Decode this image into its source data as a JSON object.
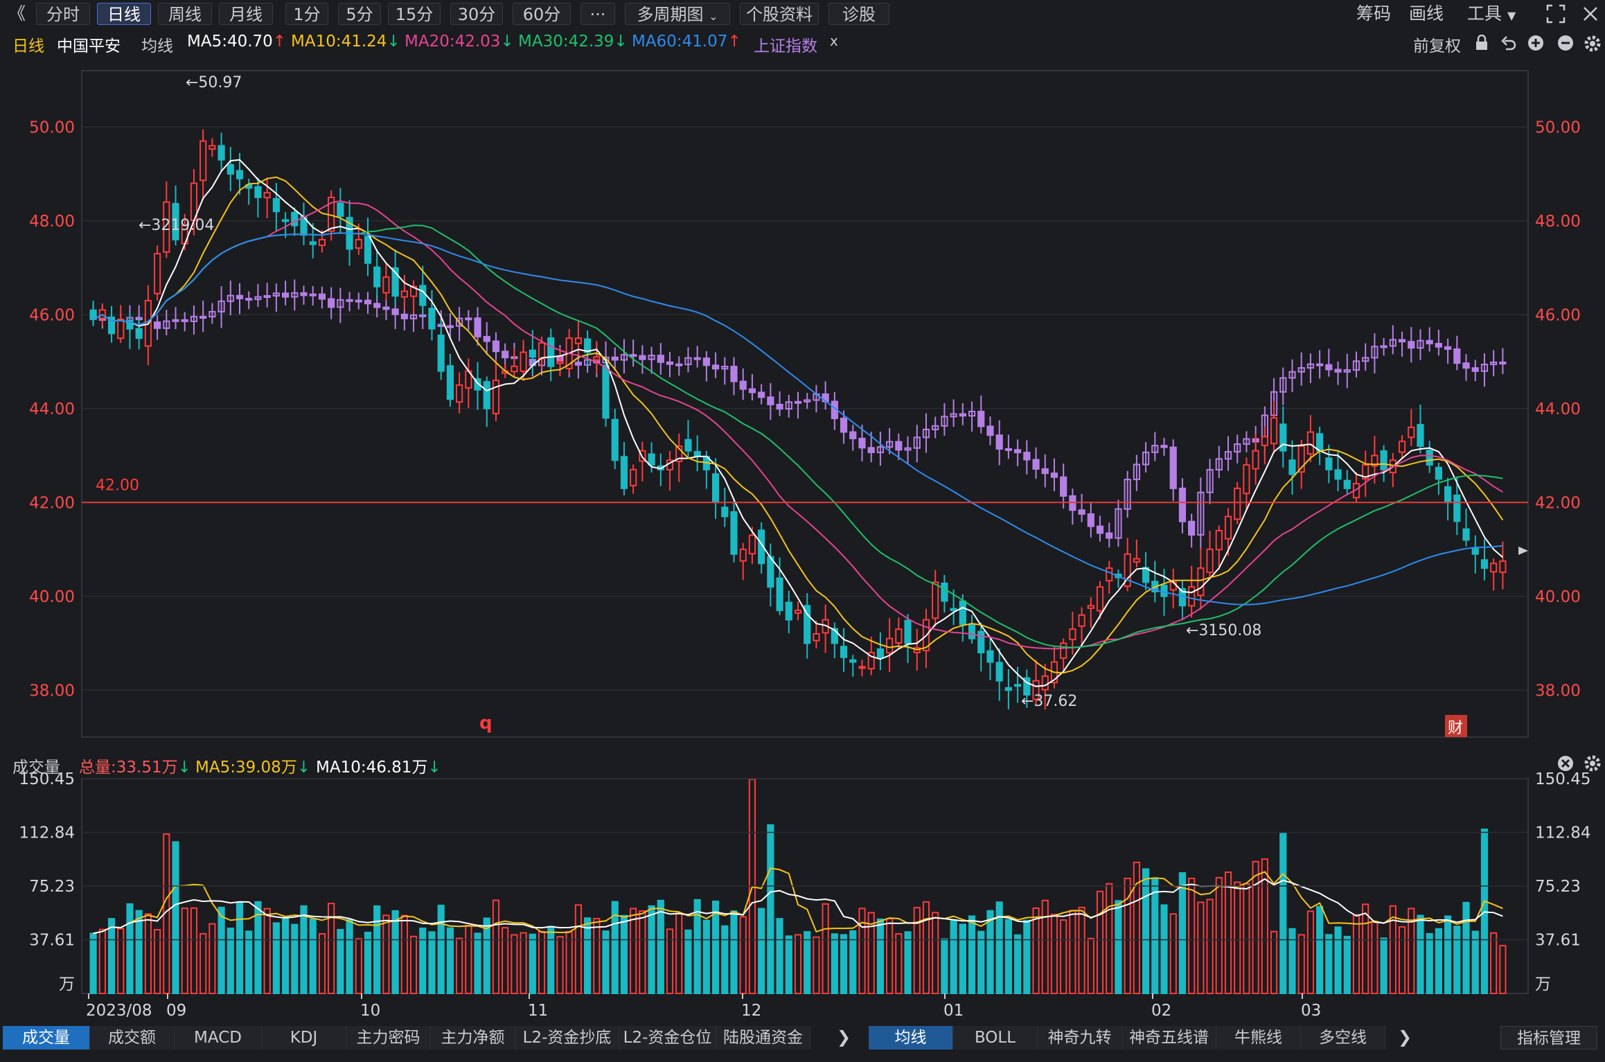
{
  "toolbar": {
    "back": "《",
    "periods": [
      "分时",
      "日线",
      "周线",
      "月线",
      "1分",
      "5分",
      "15分",
      "30分",
      "60分"
    ],
    "active_period": "日线",
    "more": "···",
    "multi_period": "多周期图",
    "stock_info": "个股资料",
    "diagnose": "诊股",
    "right": [
      "筹码",
      "画线",
      "工具"
    ]
  },
  "header": {
    "period_label": "日线",
    "stock_name": "中国平安",
    "ma_label": "均线",
    "ma": [
      {
        "label": "MA5:40.70",
        "arrow": "↑",
        "color": "#ffffff",
        "arrow_color": "#ff3b3b"
      },
      {
        "label": "MA10:41.24",
        "arrow": "↓",
        "color": "#f5c518",
        "arrow_color": "#19c37d"
      },
      {
        "label": "MA20:42.03",
        "arrow": "↓",
        "color": "#e84393",
        "arrow_color": "#19c37d"
      },
      {
        "label": "MA30:42.39",
        "arrow": "↓",
        "color": "#1fc06a",
        "arrow_color": "#19c37d"
      },
      {
        "label": "MA60:41.07",
        "arrow": "↑",
        "color": "#2d8cf0",
        "arrow_color": "#ff3b3b"
      }
    ],
    "overlay_index": "上证指数",
    "overlay_close": "x",
    "adjust": "前复权"
  },
  "price_axis": {
    "labels": [
      "50.00",
      "48.00",
      "46.00",
      "44.00",
      "42.00",
      "40.00",
      "38.00"
    ]
  },
  "annotations": {
    "high": "←50.97",
    "index_high": "←3219.04",
    "low": "←37.62",
    "index_low": "←3150.08",
    "hline_label": "42.00",
    "q_marker": "q",
    "fin_marker": "财"
  },
  "volume": {
    "title": "成交量",
    "total": "总量:33.51万",
    "total_arrow": "↓",
    "ma5": "MA5:39.08万",
    "ma5_arrow": "↓",
    "ma10": "MA10:46.81万",
    "ma10_arrow": "↓",
    "axis_labels": [
      "150.45",
      "112.84",
      "75.23",
      "37.61"
    ],
    "unit": "万"
  },
  "x_axis": {
    "labels": [
      "2023/08",
      "09",
      "10",
      "11",
      "12",
      "01",
      "02",
      "03"
    ]
  },
  "bottom_tabs_left": [
    "成交量",
    "成交额",
    "MACD",
    "KDJ",
    "主力密码",
    "主力净额",
    "L2-资金抄底",
    "L2-资金仓位",
    "陆股通资金"
  ],
  "bottom_tabs_right": [
    "均线",
    "BOLL",
    "神奇九转",
    "神奇五线谱",
    "牛熊线",
    "多空线"
  ],
  "indicator_manage": "指标管理",
  "colors": {
    "up": "#ff3b3b",
    "down": "#1bb9c3",
    "index": "#b67fe6",
    "bg": "#1b1c20",
    "grid": "#2a2c33"
  },
  "chart_data": {
    "type": "candlestick",
    "ylim": [
      37.0,
      51.2
    ],
    "hline": 42.0,
    "high": 50.97,
    "low": 37.62,
    "last_close": 40.75,
    "ma_last": {
      "MA5": 40.7,
      "MA10": 41.24,
      "MA20": 42.03,
      "MA30": 42.39,
      "MA60": 41.07
    },
    "volume_ylim": [
      0,
      150.45
    ],
    "volume_last": 33.51,
    "volume_ma5_last": 39.08,
    "volume_ma10_last": 46.81,
    "index_high": 3219.04,
    "index_low": 3150.08,
    "closes": [
      45.9,
      46.1,
      45.6,
      45.9,
      45.7,
      45.5,
      46.3,
      47.3,
      48.4,
      47.6,
      47.9,
      48.8,
      49.7,
      49.6,
      49.3,
      49.0,
      48.9,
      48.7,
      48.5,
      48.6,
      48.2,
      48.0,
      47.9,
      47.7,
      47.5,
      47.6,
      48.5,
      48.1,
      47.4,
      47.6,
      47.1,
      46.6,
      46.8,
      46.4,
      46.5,
      46.6,
      46.2,
      45.7,
      44.8,
      44.2,
      44.5,
      44.8,
      44.4,
      44.0,
      44.6,
      44.8,
      44.9,
      45.2,
      45.1,
      45.4,
      44.9,
      45.0,
      45.5,
      45.5,
      45.2,
      45.1,
      43.8,
      42.9,
      42.3,
      42.7,
      43.1,
      42.8,
      42.7,
      42.9,
      43.2,
      43.1,
      43.0,
      42.7,
      42.0,
      41.7,
      40.9,
      41.0,
      41.3,
      40.7,
      40.2,
      39.7,
      39.5,
      39.7,
      39.0,
      39.2,
      39.5,
      39.0,
      38.7,
      38.6,
      38.5,
      38.8,
      38.7,
      39.1,
      39.3,
      39.0,
      38.9,
      39.5,
      40.3,
      39.9,
      39.7,
      39.4,
      39.1,
      38.8,
      38.6,
      38.2,
      38.0,
      38.1,
      37.9,
      38.2,
      38.3,
      38.6,
      39.0,
      39.3,
      39.6,
      39.8,
      40.2,
      40.6,
      40.4,
      40.9,
      40.8,
      40.3,
      40.1,
      40.0,
      40.3,
      39.8,
      40.2,
      40.6,
      41.0,
      41.4,
      41.7,
      42.3,
      42.8,
      43.1,
      43.4,
      43.8,
      43.1,
      42.6,
      43.2,
      43.5,
      43.1,
      42.7,
      42.5,
      42.3,
      42.4,
      42.8,
      43.0,
      42.7,
      42.9,
      43.3,
      43.6,
      43.2,
      42.8,
      42.5,
      42.0,
      41.6,
      41.2,
      40.9,
      40.6,
      40.7,
      40.75
    ]
  }
}
